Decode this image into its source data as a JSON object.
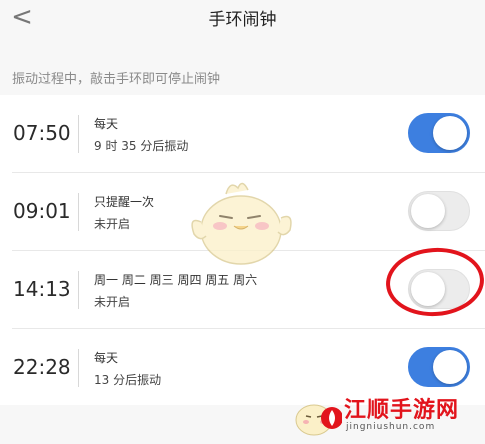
{
  "header": {
    "back_glyph": "<",
    "title": "手环闹钟"
  },
  "hint": "振动过程中，敲击手环即可停止闹钟",
  "alarms": [
    {
      "time": "07:50",
      "repeat": "每天",
      "status": "9 时 35 分后振动",
      "enabled": true
    },
    {
      "time": "09:01",
      "repeat": "只提醒一次",
      "status": "未开启",
      "enabled": false
    },
    {
      "time": "14:13",
      "repeat": "周一 周二 周三 周四 周五 周六",
      "status": "未开启",
      "enabled": false
    },
    {
      "time": "22:28",
      "repeat": "每天",
      "status": "13 分后振动",
      "enabled": true
    }
  ],
  "colors": {
    "toggle_on": "#3d7fe0",
    "annotation": "#e2141c"
  },
  "watermark": {
    "name": "江顺手游网",
    "url": "jingniushun.com"
  },
  "icons": {
    "back": "chevron-left-icon",
    "mascot": "duck-mascot-icon",
    "logo": "flame-logo-icon"
  }
}
